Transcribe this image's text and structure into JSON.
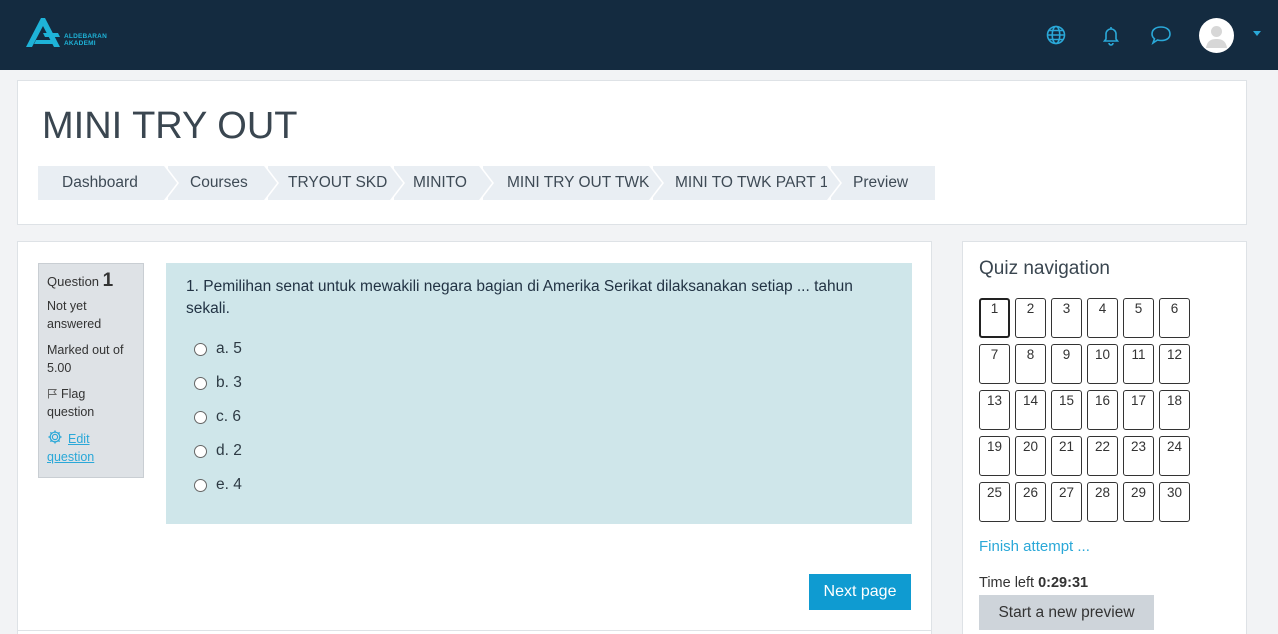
{
  "brand": {
    "name_line1": "ALDEBARAN",
    "name_line2": "AKADEMI",
    "accent_color": "#1eb3d8",
    "navbar_color": "#142b40"
  },
  "navbar": {
    "icons": [
      "globe-icon",
      "bell-icon",
      "chat-icon",
      "avatar",
      "chevron-down-icon"
    ]
  },
  "page": {
    "title": "MINI TRY OUT"
  },
  "breadcrumb": [
    {
      "label": "Dashboard"
    },
    {
      "label": "Courses"
    },
    {
      "label": "TRYOUT SKD"
    },
    {
      "label": "MINITO"
    },
    {
      "label": "MINI TRY OUT TWK"
    },
    {
      "label": "MINI TO TWK PART 1"
    },
    {
      "label": "Preview"
    }
  ],
  "question_info": {
    "question_label": "Question",
    "question_number": "1",
    "state": "Not yet answered",
    "marks": "Marked out of 5.00",
    "flag_label": "Flag question",
    "edit_label": "Edit question"
  },
  "question": {
    "text": "1. Pemilihan senat untuk mewakili negara bagian di Amerika Serikat dilaksanakan setiap ... tahun sekali.",
    "answers": [
      "a. 5",
      "b. 3",
      "c. 6",
      "d. 2",
      "e. 4"
    ]
  },
  "next_button": "Next page",
  "quiz_navigation": {
    "title": "Quiz navigation",
    "current": 1,
    "questions": [
      "1",
      "2",
      "3",
      "4",
      "5",
      "6",
      "7",
      "8",
      "9",
      "10",
      "11",
      "12",
      "13",
      "14",
      "15",
      "16",
      "17",
      "18",
      "19",
      "20",
      "21",
      "22",
      "23",
      "24",
      "25",
      "26",
      "27",
      "28",
      "29",
      "30"
    ],
    "finish_label": "Finish attempt ...",
    "time_label": "Time left",
    "time_value": "0:29:31",
    "new_preview_label": "Start a new preview"
  }
}
